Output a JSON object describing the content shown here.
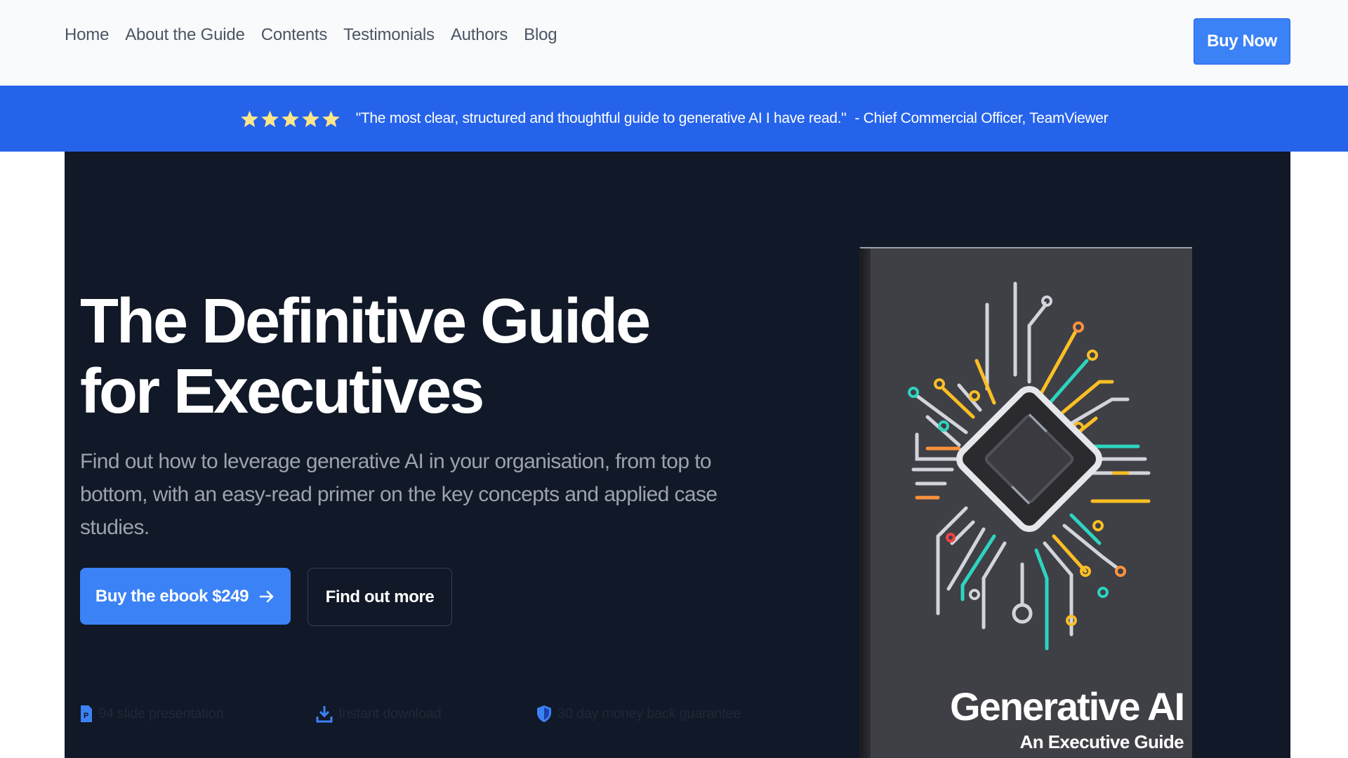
{
  "nav": {
    "links": [
      "Home",
      "About the Guide",
      "Contents",
      "Testimonials",
      "Authors",
      "Blog"
    ],
    "buy_now_label": "Buy Now"
  },
  "banner": {
    "rating": 5,
    "quote": "\"The most clear, structured and thoughtful guide to generative AI I have read.\"",
    "author": "- Chief Commercial Officer, TeamViewer",
    "background_color": "#2563eb",
    "star_color": "#fde68a"
  },
  "hero": {
    "title_line1": "The Definitive Guide",
    "title_line2": "for Executives",
    "subtitle_line1": "Find out how to leverage generative AI in your organisation, from top to",
    "subtitle_line2": "bottom, with an easy-read primer on the key concepts and applied case studies.",
    "primary_button_label": "Buy the ebook $249",
    "secondary_button_label": "Find out more",
    "features": [
      {
        "icon": "presentation-file-icon",
        "text": "94 slide presentation"
      },
      {
        "icon": "download-icon",
        "text": "Instant download"
      },
      {
        "icon": "shield-icon",
        "text": "30 day money back guarantee"
      }
    ],
    "background_color": "#111827",
    "accent_color": "#3b82f6"
  },
  "book": {
    "title": "Generative AI",
    "subtitle": "An Executive Guide",
    "cover_image": "circuit-chip-illustration"
  }
}
